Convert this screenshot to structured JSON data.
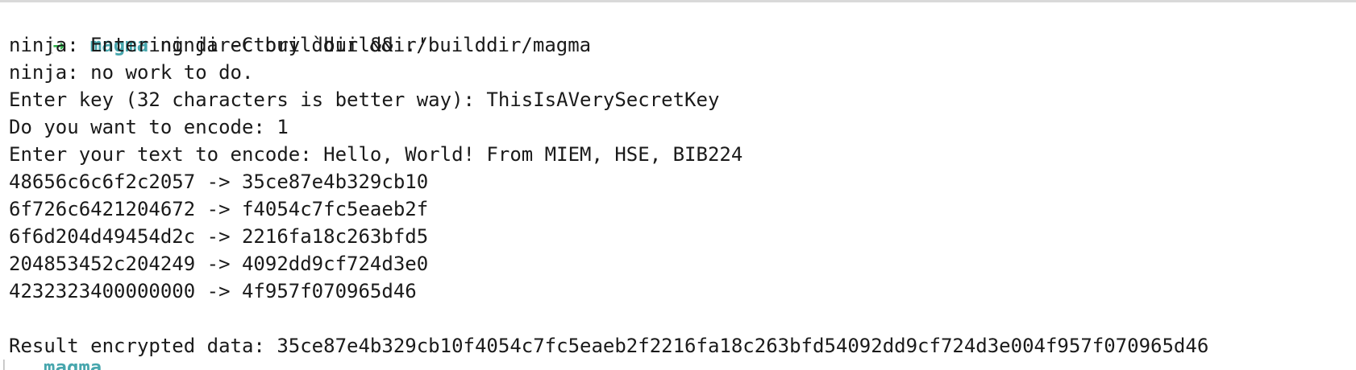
{
  "terminal": {
    "prompt": {
      "bracket": "[",
      "arrow": "→",
      "directory": "magma",
      "command": " ninja -C builddir && ./builddir/magma"
    },
    "lines": [
      "ninja: Entering directory `builddir'",
      "ninja: no work to do.",
      "Enter key (32 characters is better way): ThisIsAVerySecretKey",
      "Do you want to encode: 1",
      "Enter your text to encode: Hello, World! From MIEM, HSE, BIB224",
      "48656c6c6f2c2057 -> 35ce87e4b329cb10",
      "6f726c6421204672 -> f4054c7fc5eaeb2f",
      "6f6d204d49454d2c -> 2216fa18c263bfd5",
      "204853452c204249 -> 4092dd9cf724d3e0",
      "4232323400000000 -> 4f957f070965d46"
    ],
    "result": "Result encrypted data: 35ce87e4b329cb10f4054c7fc5eaeb2f2216fa18c263bfd54092dd9cf724d3e004f957f070965d46",
    "next_prompt": {
      "bracket": "[",
      "directory": "magma"
    },
    "colors": {
      "arrow": "#2fb34a",
      "directory": "#47a6ad",
      "text": "#1a1a1a",
      "background": "#ffffff"
    }
  }
}
